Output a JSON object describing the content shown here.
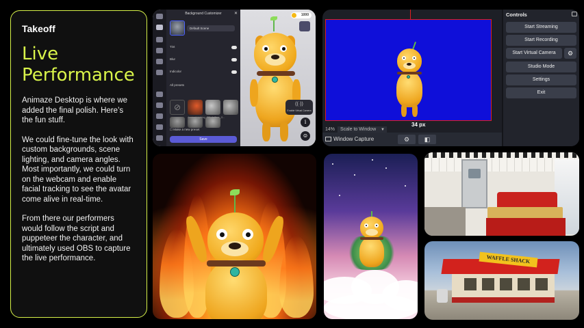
{
  "card": {
    "eyebrow": "Takeoff",
    "headline": "Live Performance",
    "paragraphs": [
      "Animaze Desktop is where we added the final polish. Here’s the fun stuff.",
      "We could fine-tune the look with custom backgrounds, scene lighting, and camera angles. Most importantly, we could turn on the webcam and enable facial tracking to see the avatar come alive in real-time.",
      "From there our performers would follow the script and puppeteer the character, and ultimately used OBS to capture the live performance."
    ]
  },
  "animaze": {
    "panel_title": "Background Customizer",
    "selected_background": "Default Scene",
    "coins": "1000",
    "rows": [
      "Tint",
      "Blur",
      "Indicolor"
    ],
    "presets_label": "All presets",
    "preset_names": [
      "Ancient Lighting",
      "SR_Jalfleur_G..."
    ],
    "checkbox_label": "Make a new preset",
    "save_label": "Save",
    "virtual_camera_label": "Enable Virtual Camera",
    "info_label": "i"
  },
  "obs": {
    "measure": "34 px",
    "zoom": "14%",
    "zoom_select": "Scale to Window",
    "source_name": "Window Capture",
    "controls_title": "Controls",
    "buttons": [
      "Start Streaming",
      "Start Recording",
      "Start Virtual Camera",
      "Studio Mode",
      "Settings",
      "Exit"
    ],
    "colors": {
      "canvas": "#0f0fd9",
      "bounds": "#e01e1e"
    }
  },
  "waffle": {
    "sign": "WAFFLE SHACK"
  },
  "accent": "#d9f44a"
}
